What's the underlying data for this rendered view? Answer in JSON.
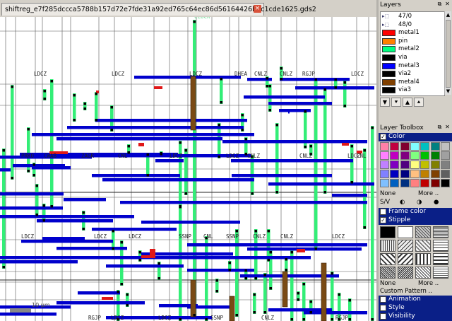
{
  "tab": {
    "title": "shiftreg_e7f285dccca5788b157d72e7fde31a92ed765c64ec86d56164426b7c1cde1625.gds2",
    "close_icon": "×"
  },
  "canvas": {
    "scale_label": "10 µm",
    "labels": [
      "LDCZ",
      "LDCZ",
      "LDCZ",
      "DHEA",
      "CNLZ",
      "CNLZ",
      "RGJP",
      "LDCZ",
      "PRKO",
      "CWAB",
      "ZAGR",
      "CNL",
      "LDCZ",
      "LDCZ",
      "CNLZ",
      "CNLZ",
      "LDCZ",
      "LDCZ",
      "LDCZ",
      "LDCZ",
      "SSNP",
      "SSNP",
      "CNLZ",
      "CNLZ",
      "LDCZ",
      "RGJP",
      "LDCZ",
      "SSNP",
      "CNLZ",
      "RGJP",
      "LDCZ",
      "CLOCK",
      "CNL",
      "CNL"
    ]
  },
  "layers_panel": {
    "title": "Layers",
    "items": [
      {
        "name": "47/0",
        "color": "#ffffff",
        "icon": "layer-group-icon"
      },
      {
        "name": "48/0",
        "color": "#ffffff",
        "icon": "layer-group-icon"
      },
      {
        "name": "metal1",
        "color": "#ff0000"
      },
      {
        "name": "pin",
        "color": "#ff8000"
      },
      {
        "name": "metal2",
        "color": "#00ff80"
      },
      {
        "name": "via",
        "color": "#000000"
      },
      {
        "name": "metal3",
        "color": "#0000ff"
      },
      {
        "name": "via2",
        "color": "#000000"
      },
      {
        "name": "metal4",
        "color": "#804000"
      },
      {
        "name": "via3",
        "color": "#000000"
      }
    ]
  },
  "layer_toolbox": {
    "title": "Layer Toolbox",
    "color_label": "Color",
    "none_label": "None",
    "more_label": "More ..",
    "sv_label": "S/V",
    "frame_color_label": "Frame color",
    "stipple_label": "Stipple",
    "stipple_none": "None",
    "stipple_more": "More ..",
    "custom_pattern": "Custom Pattern ..",
    "animation": "Animation",
    "style": "Style",
    "visibility": "Visibility"
  },
  "colors": {
    "metal2": "#33ee77",
    "metal3": "#0000cc",
    "metal4": "#7a4a14",
    "metal1": "#e01818",
    "via": "#000000"
  }
}
